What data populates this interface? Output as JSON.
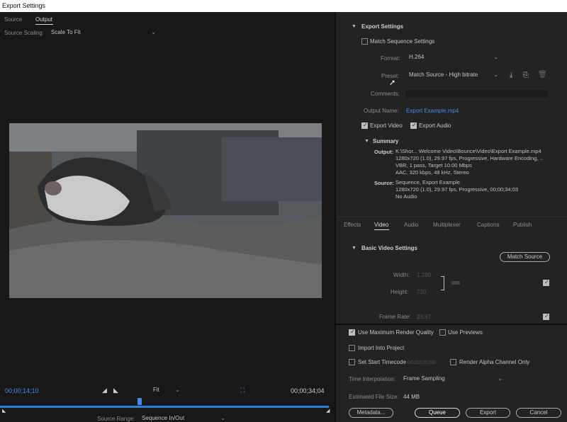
{
  "window": {
    "title": "Export Settings"
  },
  "left": {
    "tabs": [
      "Source",
      "Output"
    ],
    "source_scaling_label": "Source Scaling",
    "source_scaling_value": "Scale To Fit",
    "timecode_start": "00;00;14;10",
    "fit_value": "Fit",
    "timecode_end": "00;00;34;04",
    "source_range_label": "Source Range:",
    "source_range_value": "Sequence In/Out",
    "playhead_position": 0.42
  },
  "export_settings": {
    "header": "Export Settings",
    "match_sequence": "Match Sequence Settings",
    "format_label": "Format:",
    "format_value": "H.264",
    "preset_label": "Preset:",
    "preset_value": "Match Source - High bitrate",
    "comments_label": "Comments:",
    "output_name_label": "Output Name:",
    "output_name_value": "Export Example.mp4",
    "export_video": "Export Video",
    "export_audio": "Export Audio",
    "summary_header": "Summary",
    "output_label": "Output:",
    "output_lines": [
      "K:\\Shor... Welcome Video\\Bounce\\Video\\Export Example.mp4",
      "1280x720 (1.0), 29.97 fps, Progressive, Hardware Encoding, ..",
      "VBR, 1 pass, Target 10.00 Mbps",
      "AAC, 320 kbps, 48 kHz, Stereo"
    ],
    "source_label": "Source:",
    "source_lines": [
      "Sequence, Export Example",
      "1280x720 (1.0), 29.97 fps, Progressive, 00;00;34;03",
      "No Audio"
    ]
  },
  "settings_tabs": [
    "Effects",
    "Video",
    "Audio",
    "Multiplexer",
    "Captions",
    "Publish"
  ],
  "basic_video": {
    "header": "Basic Video Settings",
    "match_source": "Match Source",
    "width_label": "Width:",
    "width_value": "1,280",
    "height_label": "Height:",
    "height_value": "720",
    "frame_rate_label": "Frame Rate:",
    "frame_rate_value": "29.97"
  },
  "bottom": {
    "max_render_quality": "Use Maximum Render Quality",
    "use_previews": "Use Previews",
    "import_into_project": "Import Into Project",
    "set_start_timecode": "Set Start Timecode",
    "start_timecode_value": "00;00;00;00",
    "render_alpha": "Render Alpha Channel Only",
    "time_interp_label": "Time Interpolation:",
    "time_interp_value": "Frame Sampling",
    "file_size_label": "Estimated File Size:",
    "file_size_value": "44 MB",
    "buttons": {
      "metadata": "Metadata...",
      "queue": "Queue",
      "export": "Export",
      "cancel": "Cancel"
    }
  },
  "colors": {
    "accent": "#2e7bd8",
    "link": "#3f8ce8",
    "panel": "#232323",
    "background": "#181818"
  }
}
